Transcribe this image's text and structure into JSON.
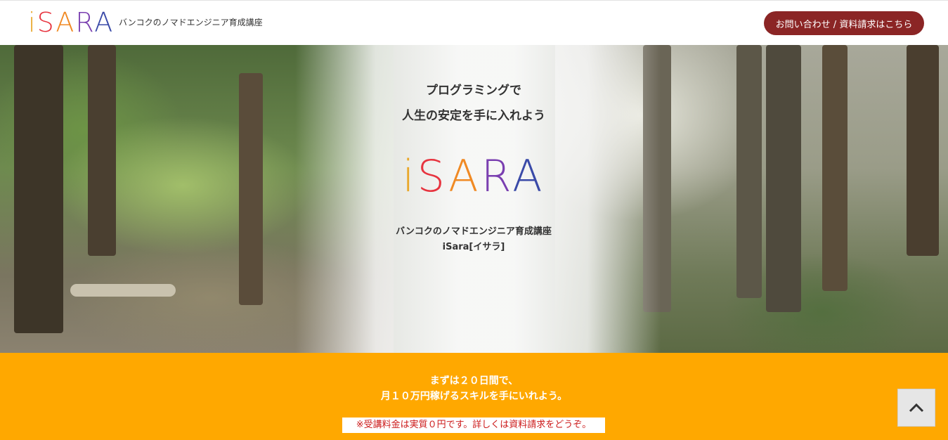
{
  "header": {
    "logo_letters": [
      "i",
      "S",
      "A",
      "R",
      "A"
    ],
    "logo_colors": [
      "#e9a72a",
      "#e7343f",
      "#f08a24",
      "#7a3fb0",
      "#3a4aa8"
    ],
    "tagline": "バンコクのノマドエンジニア育成講座",
    "cta_label": "お問い合わせ / 資料請求はこちら",
    "cta_color": "#8b2525"
  },
  "hero": {
    "heading_line1": "プログラミングで",
    "heading_line2": "人生の安定を手に入れよう",
    "logo_letters": [
      "i",
      "S",
      "A",
      "R",
      "A"
    ],
    "subtitle_line1": "バンコクのノマドエンジニア育成講座",
    "subtitle_line2": "iSara[イサラ]"
  },
  "band": {
    "line1": "まずは２０日間で、",
    "line2": "月１０万円稼げるスキルを手にいれよう。",
    "note": "※受講料金は実質０円です。詳しくは資料請求をどうぞ。",
    "background": "#ffa800"
  },
  "scroll_top": {
    "icon": "chevron-up-icon"
  }
}
